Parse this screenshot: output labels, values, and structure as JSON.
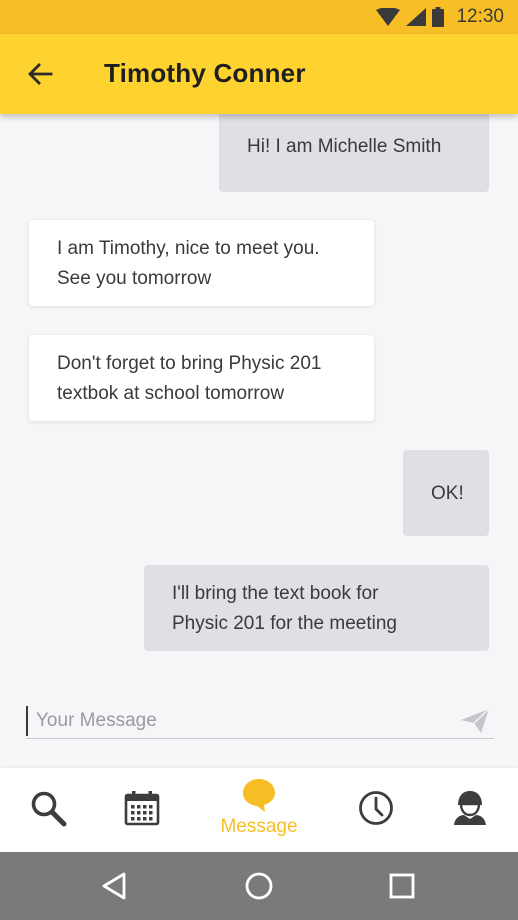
{
  "status_bar": {
    "time": "12:30",
    "icons": [
      "wifi-icon",
      "signal-icon",
      "battery-icon"
    ]
  },
  "header": {
    "back_icon": "arrow-left-icon",
    "title": "Timothy Conner"
  },
  "messages": [
    {
      "direction": "outgoing",
      "lines": [
        "Hi! I am Michelle Smith"
      ]
    },
    {
      "direction": "incoming",
      "lines": [
        "I am Timothy, nice to meet you.",
        "See you tomorrow"
      ]
    },
    {
      "direction": "incoming",
      "lines": [
        "Don't forget to bring Physic 201",
        "textbok at school tomorrow"
      ]
    },
    {
      "direction": "outgoing",
      "lines": [
        "OK!"
      ]
    },
    {
      "direction": "outgoing",
      "lines": [
        "I'll bring the text book for",
        "Physic 201 for the meeting"
      ]
    }
  ],
  "composer": {
    "value": "",
    "placeholder": "Your Message",
    "send_icon": "send-icon"
  },
  "bottom_nav": {
    "items": [
      {
        "icon": "search-icon",
        "label": ""
      },
      {
        "icon": "calendar-icon",
        "label": ""
      },
      {
        "icon": "message-icon",
        "label": "Message",
        "active": true
      },
      {
        "icon": "clock-icon",
        "label": ""
      },
      {
        "icon": "profile-icon",
        "label": ""
      }
    ]
  },
  "system_nav": {
    "icons": [
      "back-triangle-icon",
      "home-circle-icon",
      "recents-square-icon"
    ]
  },
  "colors": {
    "accent": "#fed330",
    "status_bar": "#f7bf25",
    "outgoing_bubble": "#dfe0e6",
    "incoming_bubble": "#ffffff",
    "system_nav": "#7a7a7a"
  }
}
